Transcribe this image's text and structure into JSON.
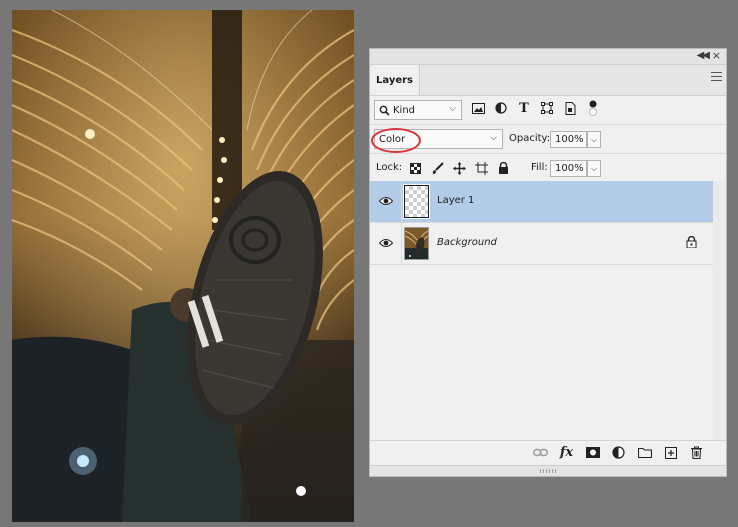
{
  "panel": {
    "tab_label": "Layers",
    "filter": {
      "kind_label": "Kind"
    },
    "blend_mode": "Color",
    "opacity_label": "Opacity:",
    "opacity_value": "100%",
    "lock_label": "Lock:",
    "fill_label": "Fill:",
    "fill_value": "100%"
  },
  "layers": [
    {
      "name": "Layer 1",
      "selected": true,
      "visible": true,
      "thumbnail": "transparent"
    },
    {
      "name": "Background",
      "selected": false,
      "visible": true,
      "locked": true,
      "thumbnail": "photo"
    }
  ],
  "icons": {
    "filter": [
      "search-icon",
      "pixel-filter-icon",
      "adjustment-filter-icon",
      "type-filter-icon",
      "shape-filter-icon",
      "smart-object-filter-icon",
      "filter-toggle-icon"
    ],
    "lock": [
      "lock-transparent-icon",
      "lock-image-icon",
      "lock-position-icon",
      "lock-artboard-icon",
      "lock-all-icon"
    ],
    "bottom": [
      "link-layers-icon",
      "fx-icon",
      "add-mask-icon",
      "adjustment-layer-icon",
      "new-group-icon",
      "new-layer-icon",
      "delete-layer-icon"
    ]
  },
  "colors": {
    "selected_row": "#b3cde9",
    "highlight_ellipse": "#d8363b",
    "workspace": "#777777"
  }
}
